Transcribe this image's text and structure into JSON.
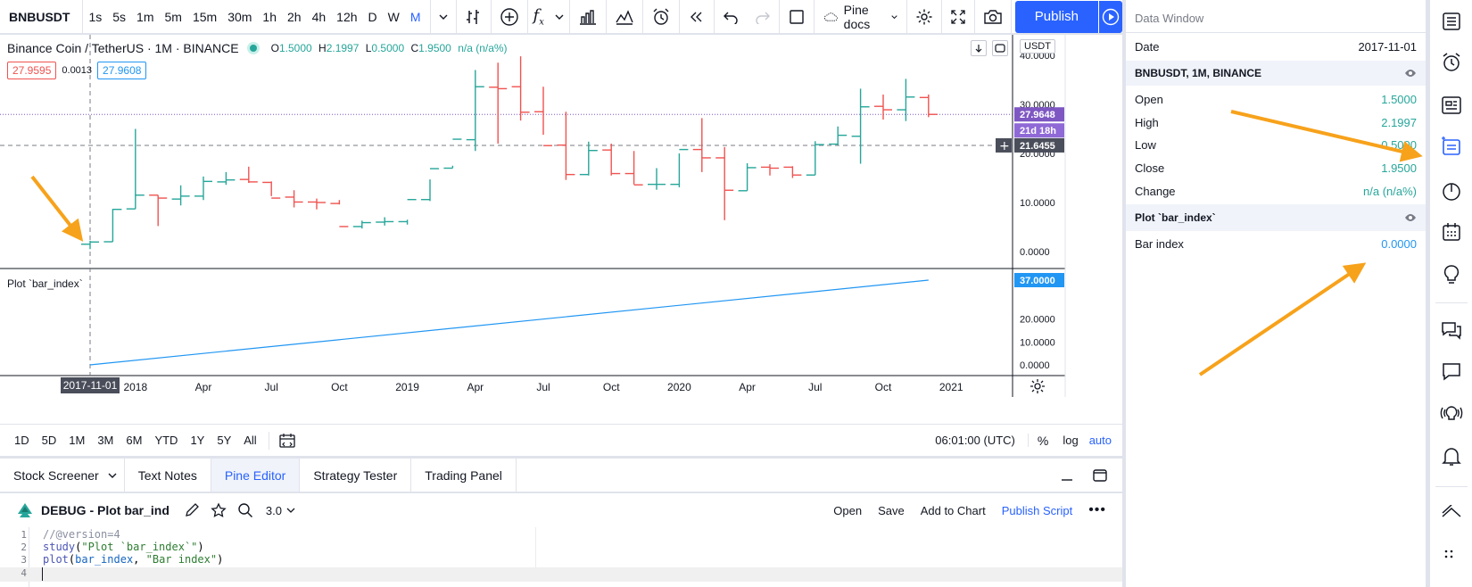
{
  "toolbar": {
    "symbol": "BNBUSDT",
    "intervals": [
      "1s",
      "5s",
      "1m",
      "5m",
      "15m",
      "30m",
      "1h",
      "2h",
      "4h",
      "12h",
      "D",
      "W",
      "M"
    ],
    "active_interval": "M",
    "pine_docs_label": "Pine docs",
    "publish_label": "Publish"
  },
  "chart": {
    "legend_title": "Binance Coin / TetherUS · 1M · BINANCE",
    "ohlc": {
      "o_label": "O",
      "o": "1.5000",
      "h_label": "H",
      "h": "2.1997",
      "l_label": "L",
      "l": "0.5000",
      "c_label": "C",
      "c": "1.9500",
      "change": "n/a (n/a%)"
    },
    "sell_price": "27.9595",
    "spread": "0.0013",
    "buy_price": "27.9608",
    "currency": "USDT",
    "price_ticks": [
      "40.0000",
      "30.0000",
      "20.0000",
      "10.0000",
      "0.0000"
    ],
    "last_price": "27.9648",
    "countdown": "21d 18h",
    "crosshair_price": "21.6455",
    "indicator_title": "Plot `bar_index`",
    "indicator_last": "37.0000",
    "indicator_ticks": [
      "20.0000",
      "10.0000",
      "0.0000"
    ],
    "time_ticks": [
      "2018",
      "Apr",
      "Jul",
      "Oct",
      "2019",
      "Apr",
      "Jul",
      "Oct",
      "2020",
      "Apr",
      "Jul",
      "Oct",
      "2021"
    ],
    "crosshair_date": "2017-11-01"
  },
  "chart_data": {
    "type": "ohlc",
    "x": [
      "2017-11",
      "2017-12",
      "2018-01",
      "2018-02",
      "2018-03",
      "2018-04",
      "2018-05",
      "2018-06",
      "2018-07",
      "2018-08",
      "2018-09",
      "2018-10",
      "2018-11",
      "2018-12",
      "2019-01",
      "2019-02",
      "2019-03",
      "2019-04",
      "2019-05",
      "2019-06",
      "2019-07",
      "2019-08",
      "2019-09",
      "2019-10",
      "2019-11",
      "2019-12",
      "2020-01",
      "2020-02",
      "2020-03",
      "2020-04",
      "2020-05",
      "2020-06",
      "2020-07",
      "2020-08",
      "2020-09",
      "2020-10",
      "2020-11",
      "2020-12"
    ],
    "open": [
      1.5,
      2.0,
      8.7,
      11.5,
      10.7,
      11.3,
      14.2,
      14.7,
      14.1,
      11.1,
      10.1,
      9.8,
      5.1,
      6.0,
      6.1,
      10.6,
      17.0,
      22.8,
      33.5,
      33.6,
      28.5,
      21.7,
      15.7,
      20.7,
      15.9,
      13.7,
      13.7,
      20.8,
      19.1,
      12.4,
      17.2,
      17.2,
      15.6,
      21.9,
      23.5,
      29.6,
      28.9,
      31.4
    ],
    "high": [
      2.2,
      8.7,
      25.0,
      11.5,
      13.5,
      15.3,
      16.2,
      17.3,
      14.3,
      12.5,
      10.8,
      10.5,
      6.3,
      7.0,
      6.5,
      14.7,
      17.5,
      37.0,
      38.5,
      39.8,
      33.6,
      28.5,
      22.4,
      22.0,
      20.5,
      17.0,
      20.0,
      27.2,
      21.3,
      18.0,
      17.8,
      17.4,
      22.5,
      25.5,
      33.2,
      32.0,
      35.2,
      32.0
    ],
    "low": [
      0.5,
      2.0,
      8.7,
      5.2,
      9.4,
      10.5,
      13.6,
      14.0,
      11.3,
      9.0,
      8.6,
      9.6,
      4.7,
      5.3,
      5.5,
      10.3,
      17.0,
      20.5,
      22.0,
      26.7,
      23.8,
      14.6,
      15.5,
      15.5,
      13.7,
      12.6,
      13.1,
      16.2,
      6.4,
      12.4,
      15.5,
      15.0,
      15.6,
      21.7,
      17.9,
      26.9,
      26.6,
      27.4
    ],
    "close": [
      1.95,
      8.6,
      11.5,
      10.9,
      11.3,
      14.3,
      14.6,
      14.2,
      10.9,
      10.1,
      10.0,
      5.1,
      5.9,
      6.1,
      10.6,
      16.9,
      22.9,
      33.6,
      33.2,
      28.4,
      21.6,
      15.7,
      20.6,
      15.9,
      13.6,
      13.7,
      20.8,
      19.1,
      12.5,
      17.1,
      17.0,
      15.6,
      21.8,
      23.7,
      29.5,
      28.9,
      31.5,
      27.96
    ],
    "indicator": {
      "name": "Bar index",
      "values_from": 0,
      "values_to": 37
    },
    "ylim": [
      0,
      40
    ],
    "indicator_ylim": [
      0,
      37
    ]
  },
  "periods": [
    "1D",
    "5D",
    "1M",
    "3M",
    "6M",
    "YTD",
    "1Y",
    "5Y",
    "All"
  ],
  "time_readout": "06:01:00 (UTC)",
  "scale_opts": {
    "percent": "%",
    "log": "log",
    "auto": "auto"
  },
  "bottom_tabs": [
    "Stock Screener",
    "Text Notes",
    "Pine Editor",
    "Strategy Tester",
    "Trading Panel"
  ],
  "active_bottom_tab": "Pine Editor",
  "editor": {
    "script_name": "DEBUG - Plot bar_ind",
    "version": "3.0",
    "actions": [
      "Open",
      "Save",
      "Add to Chart",
      "Publish Script"
    ],
    "lines": [
      "//@version=4",
      "study(\"Plot `bar_index`\")",
      "plot(bar_index, \"Bar index\")",
      ""
    ]
  },
  "data_window": {
    "title": "Data Window",
    "date_label": "Date",
    "date_value": "2017-11-01",
    "section1": "BNBUSDT, 1M, BINANCE",
    "rows": [
      {
        "label": "Open",
        "value": "1.5000"
      },
      {
        "label": "High",
        "value": "2.1997"
      },
      {
        "label": "Low",
        "value": "0.5000"
      },
      {
        "label": "Close",
        "value": "1.9500"
      },
      {
        "label": "Change",
        "value": "n/a (n/a%)"
      }
    ],
    "section2": "Plot `bar_index`",
    "plot_label": "Bar index",
    "plot_value": "0.0000"
  },
  "colors": {
    "up": "#26a69a",
    "down": "#ef5350",
    "accent": "#2962ff",
    "indicator": "#2196f3",
    "annotation": "#f7a21b",
    "last_price": "#7e57c2"
  }
}
